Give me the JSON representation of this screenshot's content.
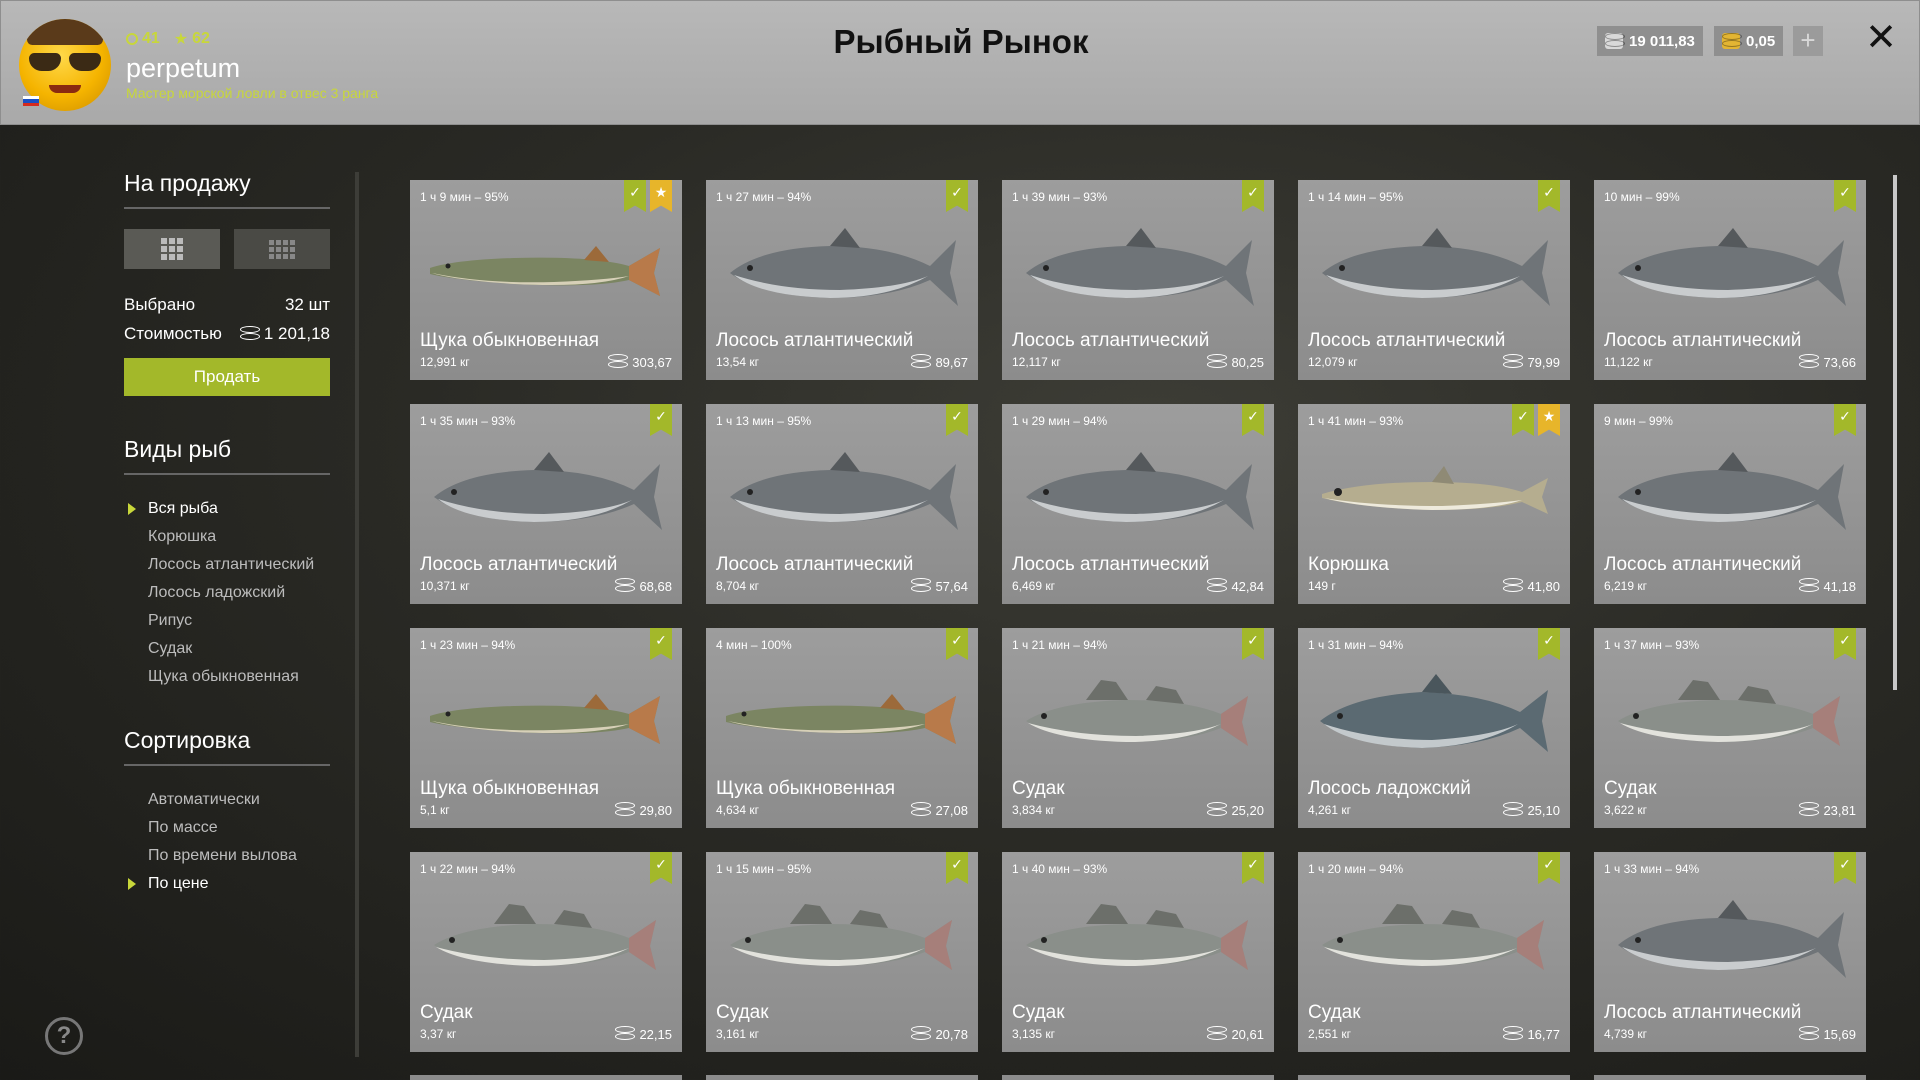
{
  "header": {
    "title": "Рыбный Рынок",
    "username": "perpetum",
    "rank": "Мастер морской ловли в отвес 3 ранга",
    "level": "41",
    "stars": "62",
    "silver": "19 011,83",
    "gold": "0,05",
    "plus": "+",
    "close": "✕"
  },
  "sidebar": {
    "sale_title": "На продажу",
    "selected_label": "Выбрано",
    "selected_value": "32 шт",
    "cost_label": "Стоимостью",
    "cost_value": "1 201,18",
    "sell_label": "Продать",
    "species_title": "Виды рыб",
    "species": [
      "Вся рыба",
      "Корюшка",
      "Лосось атлантический",
      "Лосось ладожский",
      "Рипус",
      "Судак",
      "Щука обыкновенная"
    ],
    "sort_title": "Сортировка",
    "sort": [
      "Автоматически",
      "По массе",
      "По времени вылова",
      "По цене"
    ]
  },
  "cards": [
    {
      "time": "1 ч 9 мин – 95%",
      "name": "Щука обыкновенная",
      "weight": "12,991 кг",
      "price": "303,67",
      "fish": "pike",
      "star": true
    },
    {
      "time": "1 ч 27 мин – 94%",
      "name": "Лосось атлантический",
      "weight": "13,54 кг",
      "price": "89,67",
      "fish": "salmon",
      "star": false
    },
    {
      "time": "1 ч 39 мин – 93%",
      "name": "Лосось атлантический",
      "weight": "12,117 кг",
      "price": "80,25",
      "fish": "salmon",
      "star": false
    },
    {
      "time": "1 ч 14 мин – 95%",
      "name": "Лосось атлантический",
      "weight": "12,079 кг",
      "price": "79,99",
      "fish": "salmon",
      "star": false
    },
    {
      "time": "10 мин – 99%",
      "name": "Лосось атлантический",
      "weight": "11,122 кг",
      "price": "73,66",
      "fish": "salmon",
      "star": false
    },
    {
      "time": "1 ч 35 мин – 93%",
      "name": "Лосось атлантический",
      "weight": "10,371 кг",
      "price": "68,68",
      "fish": "salmon",
      "star": false
    },
    {
      "time": "1 ч 13 мин – 95%",
      "name": "Лосось атлантический",
      "weight": "8,704 кг",
      "price": "57,64",
      "fish": "salmon",
      "star": false
    },
    {
      "time": "1 ч 29 мин – 94%",
      "name": "Лосось атлантический",
      "weight": "6,469 кг",
      "price": "42,84",
      "fish": "salmon",
      "star": false
    },
    {
      "time": "1 ч 41 мин – 93%",
      "name": "Корюшка",
      "weight": "149 г",
      "price": "41,80",
      "fish": "smelt",
      "star": true
    },
    {
      "time": "9 мин – 99%",
      "name": "Лосось атлантический",
      "weight": "6,219 кг",
      "price": "41,18",
      "fish": "salmon",
      "star": false
    },
    {
      "time": "1 ч 23 мин – 94%",
      "name": "Щука обыкновенная",
      "weight": "5,1 кг",
      "price": "29,80",
      "fish": "pike",
      "star": false
    },
    {
      "time": "4 мин – 100%",
      "name": "Щука обыкновенная",
      "weight": "4,634 кг",
      "price": "27,08",
      "fish": "pike",
      "star": false
    },
    {
      "time": "1 ч 21 мин – 94%",
      "name": "Судак",
      "weight": "3,834 кг",
      "price": "25,20",
      "fish": "zander",
      "star": false
    },
    {
      "time": "1 ч 31 мин – 94%",
      "name": "Лосось ладожский",
      "weight": "4,261 кг",
      "price": "25,10",
      "fish": "ladoga",
      "star": false
    },
    {
      "time": "1 ч 37 мин – 93%",
      "name": "Судак",
      "weight": "3,622 кг",
      "price": "23,81",
      "fish": "zander",
      "star": false
    },
    {
      "time": "1 ч 22 мин – 94%",
      "name": "Судак",
      "weight": "3,37 кг",
      "price": "22,15",
      "fish": "zander",
      "star": false
    },
    {
      "time": "1 ч 15 мин – 95%",
      "name": "Судак",
      "weight": "3,161 кг",
      "price": "20,78",
      "fish": "zander",
      "star": false
    },
    {
      "time": "1 ч 40 мин – 93%",
      "name": "Судак",
      "weight": "3,135 кг",
      "price": "20,61",
      "fish": "zander",
      "star": false
    },
    {
      "time": "1 ч 20 мин – 94%",
      "name": "Судак",
      "weight": "2,551 кг",
      "price": "16,77",
      "fish": "zander",
      "star": false
    },
    {
      "time": "1 ч 33 мин – 94%",
      "name": "Лосось атлантический",
      "weight": "4,739 кг",
      "price": "15,69",
      "fish": "salmon",
      "star": false
    }
  ],
  "colors": {
    "accent": "#a3b82a",
    "star": "#e7b52a",
    "silver_coin": "#d9d9d9",
    "gold_coin": "#e3b533"
  }
}
